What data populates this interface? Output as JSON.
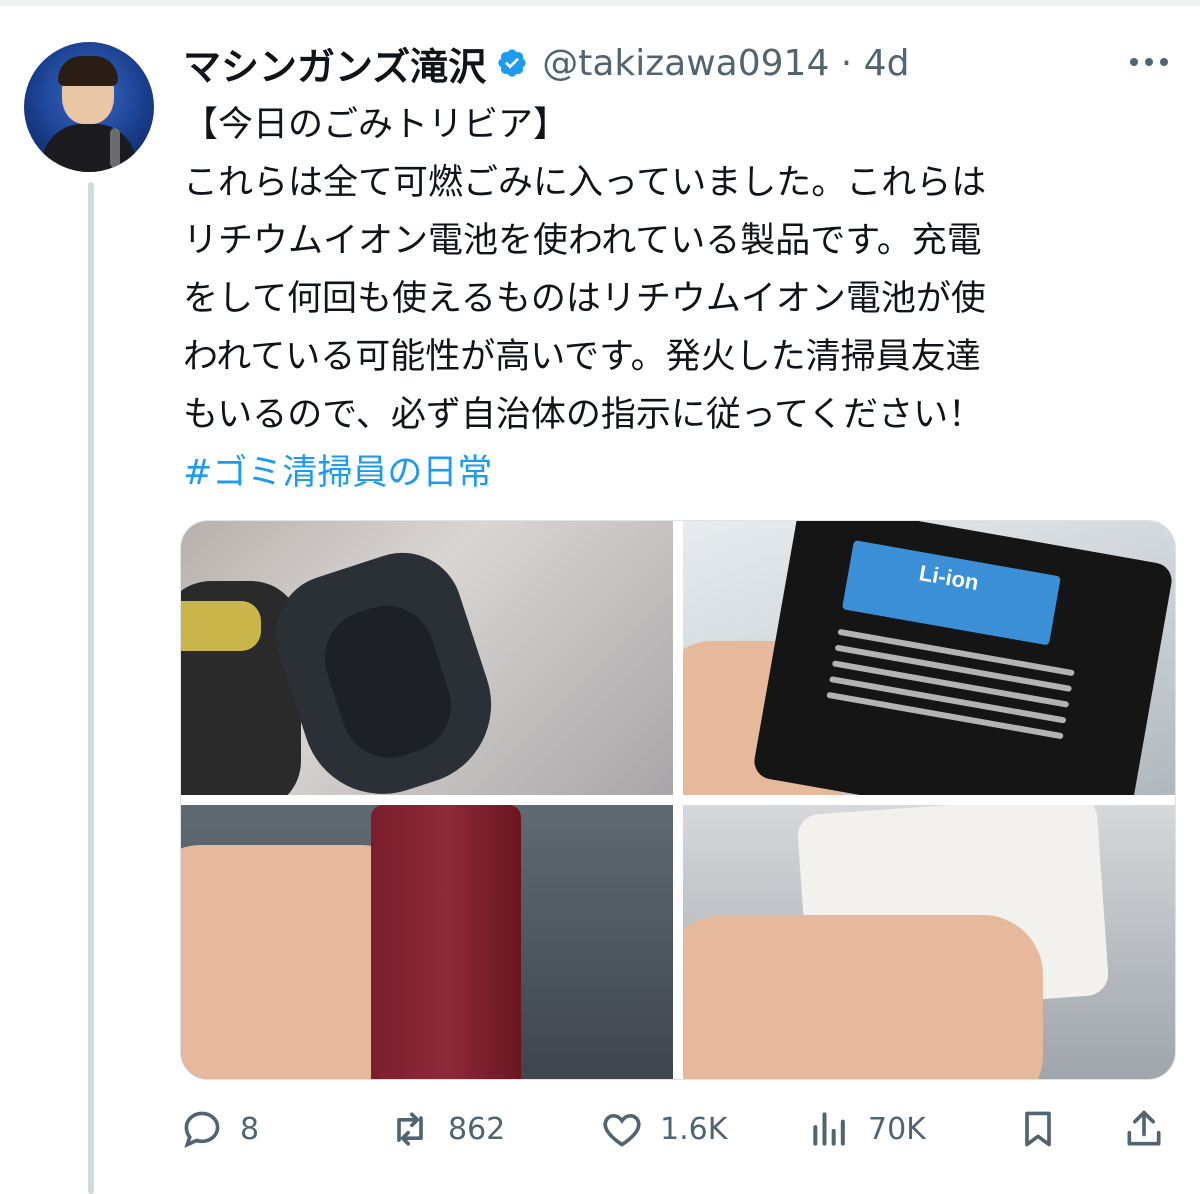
{
  "tweet": {
    "author_name": "マシンガンズ滝沢",
    "handle_time": "@takizawa0914 · 4d",
    "lines": [
      "【今日のごみトリビア】",
      "これらは全て可燃ごみに入っていました。これらは",
      "リチウムイオン電池を使われている製品です。充電",
      "をして何回も使えるものはリチウムイオン電池が使",
      "われている可能性が高いです。発火した清掃員友達",
      "もいるので、必ず自治体の指示に従ってください！"
    ],
    "hashtag": "#ゴミ清掃員の日常"
  },
  "media": {
    "photo_2_label": "Li-ion"
  },
  "actions": {
    "replies": "8",
    "reposts": "862",
    "likes": "1.6K",
    "views": "70K"
  },
  "colors": {
    "accent": "#1d9bf0",
    "muted": "#536471",
    "text": "#0f1419"
  }
}
